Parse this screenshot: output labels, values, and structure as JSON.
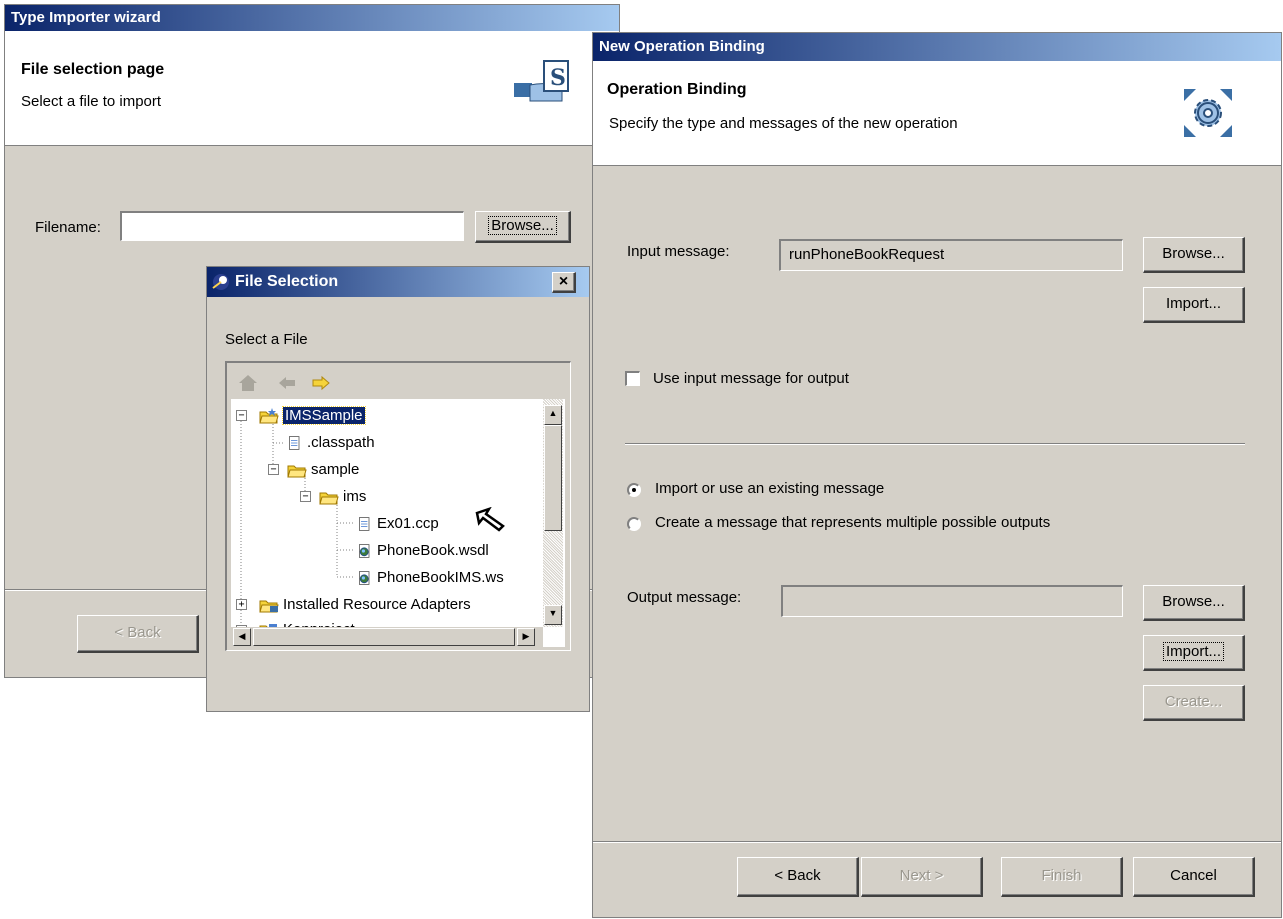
{
  "type_importer": {
    "title": "Type Importer wizard",
    "heading": "File selection page",
    "subheading": "Select a file to import",
    "filename_label": "Filename:",
    "filename_value": "",
    "browse_label": "Browse...",
    "back_label": "< Back"
  },
  "file_selection": {
    "title": "File Selection",
    "close_label": "×",
    "prompt": "Select a File",
    "tree": [
      {
        "label": "IMSSample",
        "expander": "−",
        "icon": "project-folder-icon",
        "selected": true
      },
      {
        "label": ".classpath",
        "icon": "file-icon"
      },
      {
        "label": "sample",
        "expander": "−",
        "icon": "folder-icon"
      },
      {
        "label": "ims",
        "expander": "−",
        "icon": "folder-icon"
      },
      {
        "label": "Ex01.ccp",
        "icon": "file-icon"
      },
      {
        "label": "PhoneBook.wsdl",
        "icon": "wsdl-icon"
      },
      {
        "label": "PhoneBookIMS.ws",
        "icon": "wsdl-icon"
      },
      {
        "label": "Installed Resource Adapters",
        "expander": "+",
        "icon": "folder-icon"
      },
      {
        "label": "Kenproject",
        "expander": "+",
        "icon": "project-folder-icon"
      }
    ]
  },
  "operation_binding": {
    "title": "New Operation Binding",
    "heading": "Operation Binding",
    "subheading": "Specify the type and messages of the new operation",
    "input_label": "Input message:",
    "input_value": "runPhoneBookRequest",
    "browse_label": "Browse...",
    "import_label": "Import...",
    "use_input_label": "Use input message for output",
    "use_input_checked": false,
    "radio_import_label": "Import or use an existing message",
    "radio_create_label": "Create a message that represents multiple possible outputs",
    "selected_radio": "import",
    "output_label": "Output message:",
    "output_value": "",
    "browse2_label": "Browse...",
    "import2_label": "Import...",
    "create_label": "Create...",
    "back_label": "< Back",
    "next_label": "Next >",
    "finish_label": "Finish",
    "cancel_label": "Cancel"
  },
  "colors": {
    "title_start": "#0a246a",
    "title_end": "#a6caf0",
    "dialog_bg": "#d4d0c8",
    "selection": "#0a246a"
  }
}
